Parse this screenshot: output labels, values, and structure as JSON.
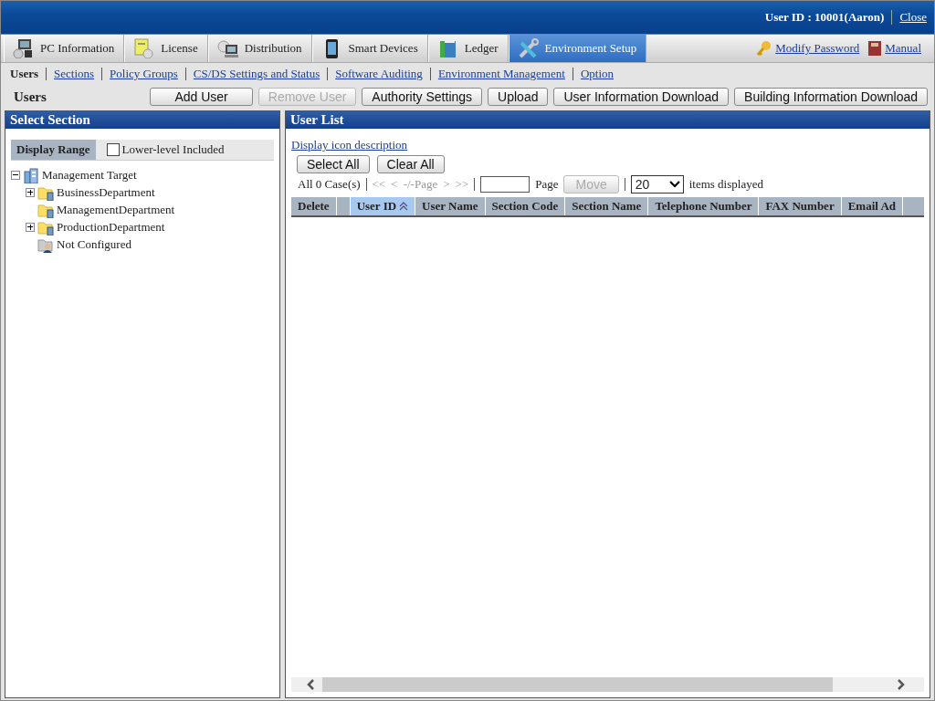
{
  "header": {
    "user_id": "User ID : 10001(Aaron)",
    "close": "Close"
  },
  "main_tabs": [
    {
      "label": "PC Information",
      "selected": false
    },
    {
      "label": "License",
      "selected": false
    },
    {
      "label": "Distribution",
      "selected": false
    },
    {
      "label": "Smart Devices",
      "selected": false
    },
    {
      "label": "Ledger",
      "selected": false
    },
    {
      "label": "Environment Setup",
      "selected": true
    }
  ],
  "header_links": [
    "Modify Password",
    "Manual"
  ],
  "sub_nav": [
    {
      "label": "Users",
      "selected": true
    },
    {
      "label": "Sections",
      "selected": false
    },
    {
      "label": "Policy Groups",
      "selected": false
    },
    {
      "label": "CS/DS Settings and Status",
      "selected": false
    },
    {
      "label": "Software Auditing",
      "selected": false
    },
    {
      "label": "Environment Management",
      "selected": false
    },
    {
      "label": "Option",
      "selected": false
    }
  ],
  "page_title": "Users",
  "toolbar": [
    {
      "label": "Add User",
      "disabled": false
    },
    {
      "label": "Remove User",
      "disabled": true
    },
    {
      "label": "Authority Settings",
      "disabled": false
    },
    {
      "label": "Upload",
      "disabled": false
    },
    {
      "label": "User Information Download",
      "disabled": false
    },
    {
      "label": "Building Information Download",
      "disabled": false
    }
  ],
  "select_section": {
    "title": "Select Section",
    "display_range": "Display Range",
    "lower_level": {
      "label": "Lower-level Included",
      "checked": false
    },
    "tree": [
      {
        "label": "Management Target",
        "kind": "root",
        "expanded": true,
        "children": [
          {
            "label": "BusinessDepartment",
            "kind": "folder",
            "expanded": false
          },
          {
            "label": "ManagementDepartment",
            "kind": "folder"
          },
          {
            "label": "ProductionDepartment",
            "kind": "folder",
            "expanded": false
          },
          {
            "label": "Not Configured",
            "kind": "user"
          }
        ]
      }
    ]
  },
  "user_list": {
    "title": "User List",
    "icon_link": "Display icon description",
    "buttons": [
      "Select All",
      "Clear All"
    ],
    "count": "All 0 Case(s)",
    "pager": [
      {
        "label": "<<",
        "disabled": true
      },
      {
        "label": "<",
        "disabled": true
      },
      {
        "label": "-/-Page",
        "disabled": true
      },
      {
        "label": ">",
        "disabled": true
      },
      {
        "label": ">>",
        "disabled": true
      }
    ],
    "page_label": "Page",
    "move": {
      "label": "Move",
      "disabled": true
    },
    "per_page": "20",
    "per_page_label": "items displayed",
    "columns": [
      {
        "label": "Delete",
        "kind": "text",
        "selected": false
      },
      {
        "kind": "blank",
        "selected": false
      },
      {
        "label": "User ID",
        "kind": "text",
        "selected": true
      },
      {
        "label": "User Name",
        "kind": "text",
        "selected": false
      },
      {
        "label": "Section Code",
        "kind": "text",
        "selected": false
      },
      {
        "label": "Section Name",
        "kind": "text",
        "selected": false
      },
      {
        "label": "Telephone Number",
        "kind": "text",
        "selected": false
      },
      {
        "label": "FAX Number",
        "kind": "text",
        "selected": false
      },
      {
        "label": "Email Ad",
        "kind": "text",
        "selected": false
      }
    ]
  }
}
